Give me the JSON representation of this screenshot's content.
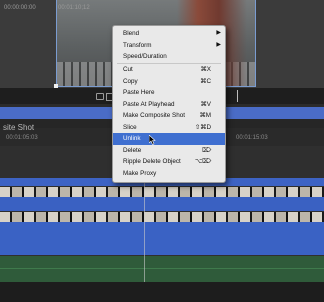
{
  "timecodes": {
    "viewer_left": "00:00:00:00",
    "viewer_mid": "00:01:10;12",
    "ruler_left": "00:01:05:03",
    "ruler_right": "00:01:15:03"
  },
  "timeline": {
    "clip_label": "site Shot"
  },
  "menu": {
    "items": [
      {
        "label": "Blend",
        "shortcut": "",
        "submenu": "▶"
      },
      {
        "label": "Transform",
        "shortcut": "",
        "submenu": "▶"
      },
      {
        "label": "Speed/Duration",
        "shortcut": ""
      },
      {
        "label": "Cut",
        "shortcut": "⌘X"
      },
      {
        "label": "Copy",
        "shortcut": "⌘C"
      },
      {
        "label": "Paste Here",
        "shortcut": ""
      },
      {
        "label": "Paste At Playhead",
        "shortcut": "⌘V"
      },
      {
        "label": "Make Composite Shot",
        "shortcut": "⌘M"
      },
      {
        "label": "Slice",
        "shortcut": "⇧⌘D"
      },
      {
        "label": "Unlink",
        "shortcut": "",
        "selected": true
      },
      {
        "label": "Delete",
        "shortcut": "⌦"
      },
      {
        "label": "Ripple Delete Object",
        "shortcut": "⌥⌦"
      },
      {
        "label": "Make Proxy",
        "shortcut": ""
      }
    ]
  },
  "colors": {
    "selection": "#3f6fd0",
    "timeline_blue": "#3a62c4",
    "audio_green": "#2f5b3a"
  },
  "icons": {
    "transport_icon": "loop-icon",
    "cursor": "pointer-cursor-icon"
  }
}
